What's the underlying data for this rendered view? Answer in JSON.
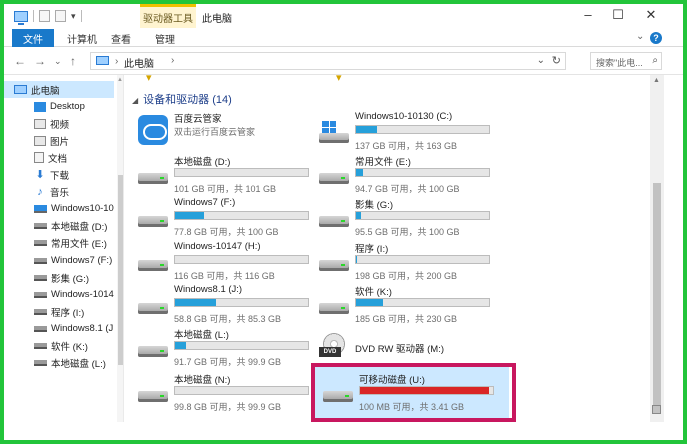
{
  "window": {
    "context_tab": "驱动器工具",
    "title": "此电脑"
  },
  "ribbon": {
    "tabs": [
      {
        "label": "文件"
      },
      {
        "label": "计算机"
      },
      {
        "label": "查看"
      },
      {
        "label": "管理"
      }
    ]
  },
  "address": {
    "crumb_sep": "›",
    "location": "此电脑",
    "crumb_after": "›",
    "search_placeholder": "搜索\"此电...",
    "refresh_glyph": "↻",
    "dropdown_glyph": "⌄"
  },
  "nav": {
    "items": [
      {
        "label": "此电脑",
        "icon": "pc-icon",
        "selected": true
      },
      {
        "label": "Desktop",
        "icon": "desktop-icon"
      },
      {
        "label": "视频",
        "icon": "video-icon"
      },
      {
        "label": "图片",
        "icon": "pictures-icon"
      },
      {
        "label": "文档",
        "icon": "document-icon"
      },
      {
        "label": "下载",
        "icon": "download-icon"
      },
      {
        "label": "音乐",
        "icon": "music-icon"
      },
      {
        "label": "Windows10-10",
        "icon": "windows-drive-icon"
      },
      {
        "label": "本地磁盘 (D:)",
        "icon": "drive-icon"
      },
      {
        "label": "常用文件 (E:)",
        "icon": "drive-icon"
      },
      {
        "label": "Windows7 (F:)",
        "icon": "drive-icon"
      },
      {
        "label": "影集 (G:)",
        "icon": "drive-icon"
      },
      {
        "label": "Windows-1014",
        "icon": "drive-icon"
      },
      {
        "label": "程序 (I:)",
        "icon": "drive-icon"
      },
      {
        "label": "Windows8.1 (J:",
        "icon": "drive-icon"
      },
      {
        "label": "软件 (K:)",
        "icon": "drive-icon"
      },
      {
        "label": "本地磁盘 (L:)",
        "icon": "drive-icon"
      }
    ]
  },
  "content": {
    "group_title": "设备和驱动器 (14)",
    "baidu": {
      "name": "百度云管家",
      "sub": "双击运行百度云管家"
    },
    "drives": [
      {
        "id": "c",
        "name": "Windows10-10130 (C:)",
        "free": "137 GB 可用，共 163 GB",
        "used_fraction": 0.16
      },
      {
        "id": "d",
        "name": "本地磁盘 (D:)",
        "free": "101 GB 可用，共 101 GB",
        "used_fraction": 0.0
      },
      {
        "id": "e",
        "name": "常用文件 (E:)",
        "free": "94.7 GB 可用，共 100 GB",
        "used_fraction": 0.05
      },
      {
        "id": "f",
        "name": "Windows7 (F:)",
        "free": "77.8 GB 可用，共 100 GB",
        "used_fraction": 0.22
      },
      {
        "id": "g",
        "name": "影集 (G:)",
        "free": "95.5 GB 可用，共 100 GB",
        "used_fraction": 0.04
      },
      {
        "id": "h",
        "name": "Windows-10147 (H:)",
        "free": "116 GB 可用，共 116 GB",
        "used_fraction": 0.0
      },
      {
        "id": "i",
        "name": "程序 (I:)",
        "free": "198 GB 可用，共 200 GB",
        "used_fraction": 0.01
      },
      {
        "id": "j",
        "name": "Windows8.1 (J:)",
        "free": "58.8 GB 可用，共 85.3 GB",
        "used_fraction": 0.31
      },
      {
        "id": "k",
        "name": "软件 (K:)",
        "free": "185 GB 可用，共 230 GB",
        "used_fraction": 0.2
      },
      {
        "id": "l",
        "name": "本地磁盘 (L:)",
        "free": "91.7 GB 可用，共 99.9 GB",
        "used_fraction": 0.08
      },
      {
        "id": "n",
        "name": "本地磁盘 (N:)",
        "free": "99.8 GB 可用，共 99.9 GB",
        "used_fraction": 0.0
      },
      {
        "id": "u",
        "name": "可移动磁盘 (U:)",
        "free": "100 MB 可用，共 3.41 GB",
        "used_fraction": 0.97
      }
    ],
    "dvd": {
      "name": "DVD RW 驱动器 (M:)",
      "badge": "DVD"
    }
  }
}
